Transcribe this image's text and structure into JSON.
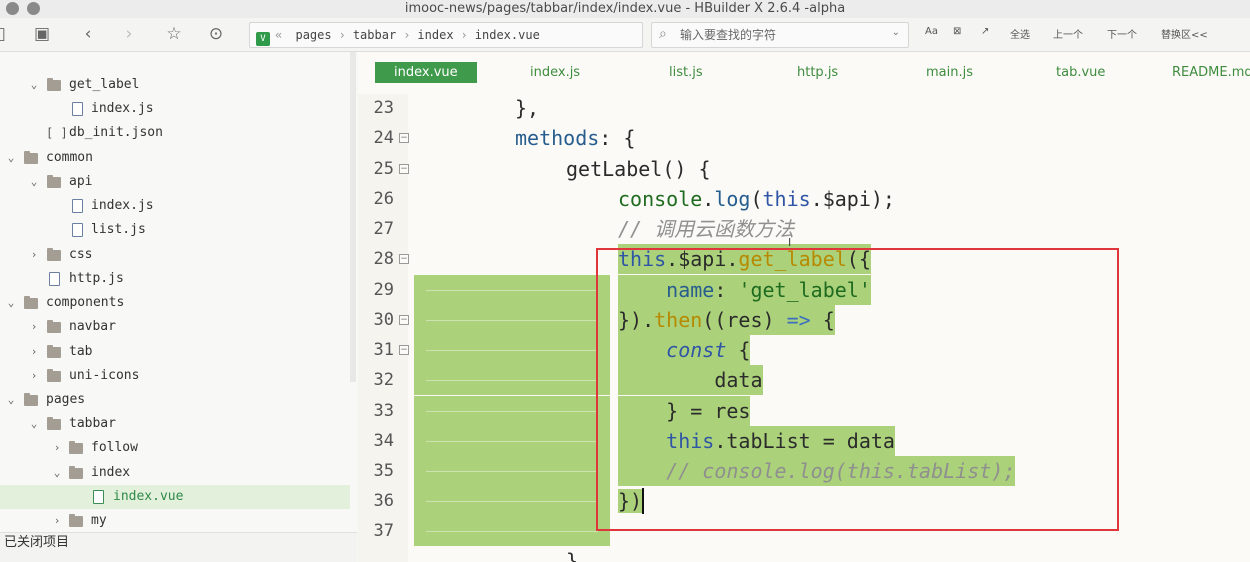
{
  "window": {
    "title": "imooc-news/pages/tabbar/index/index.vue - HBuilder X 2.6.4 -alpha"
  },
  "breadcrumb": {
    "prefix": "«",
    "items": [
      "pages",
      "tabbar",
      "index",
      "index.vue"
    ]
  },
  "search": {
    "placeholder": "输入要查找的字符"
  },
  "toolbar": {
    "buttons": [
      "Aa",
      "⊠",
      "↗",
      "全选",
      "上一个",
      "下一个",
      "替换区<<"
    ]
  },
  "sidebar": {
    "items": [
      {
        "label": "get_label",
        "type": "folder",
        "expanded": true
      },
      {
        "label": "index.js",
        "type": "file"
      },
      {
        "label": "db_init.json",
        "type": "json"
      },
      {
        "label": "common",
        "type": "folder",
        "expanded": true
      },
      {
        "label": "api",
        "type": "folder",
        "expanded": true
      },
      {
        "label": "index.js",
        "type": "file"
      },
      {
        "label": "list.js",
        "type": "file"
      },
      {
        "label": "css",
        "type": "folder",
        "expanded": false
      },
      {
        "label": "http.js",
        "type": "file"
      },
      {
        "label": "components",
        "type": "folder",
        "expanded": true
      },
      {
        "label": "navbar",
        "type": "folder",
        "expanded": false
      },
      {
        "label": "tab",
        "type": "folder",
        "expanded": false
      },
      {
        "label": "uni-icons",
        "type": "folder",
        "expanded": false
      },
      {
        "label": "pages",
        "type": "folder",
        "expanded": true
      },
      {
        "label": "tabbar",
        "type": "folder",
        "expanded": true
      },
      {
        "label": "follow",
        "type": "folder",
        "expanded": false
      },
      {
        "label": "index",
        "type": "folder",
        "expanded": true
      },
      {
        "label": "index.vue",
        "type": "vue",
        "selected": true
      },
      {
        "label": "my",
        "type": "folder",
        "expanded": false
      }
    ]
  },
  "statusbar": {
    "text": "已关闭项目"
  },
  "tabs": [
    "index.vue",
    "index.js",
    "list.js",
    "http.js",
    "main.js",
    "tab.vue",
    "README.md"
  ],
  "editor": {
    "line_numbers": [
      "23",
      "24",
      "25",
      "26",
      "27",
      "28",
      "29",
      "30",
      "31",
      "32",
      "33",
      "34",
      "35",
      "36",
      "37"
    ],
    "code": {
      "l23": "},",
      "l24_a": "methods",
      "l24_b": ": {",
      "l25": "getLabel() {",
      "l26_a": "console",
      "l26_b": ".",
      "l26_c": "log",
      "l26_d": "(",
      "l26_e": "this",
      "l26_f": ".$api);",
      "l27": "// 调用云函数方法",
      "l28_a": "this",
      "l28_b": ".$api.",
      "l28_c": "get_label",
      "l28_d": "({",
      "l29_a": "name",
      "l29_b": ": ",
      "l29_c": "'get_label'",
      "l30_a": "}).",
      "l30_b": "then",
      "l30_c": "((res) ",
      "l30_d": "=>",
      "l30_e": " {",
      "l31_a": "const",
      "l31_b": " {",
      "l32": "data",
      "l33": "} = res",
      "l34_a": "this",
      "l34_b": ".tabList = data",
      "l35": "// console.log(this.tabList);",
      "l36": "})",
      "l37": "}"
    }
  },
  "colors": {
    "accent": "#3f9a4b",
    "selection": "#abd27a",
    "annotation": "#e0353b"
  }
}
